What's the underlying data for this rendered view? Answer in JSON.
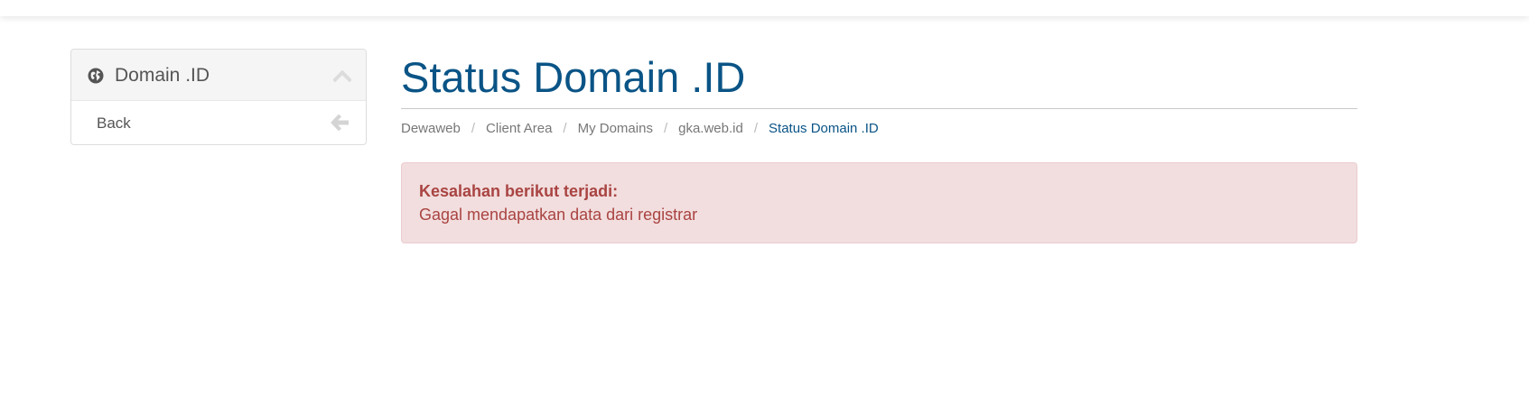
{
  "sidebar": {
    "title": "Domain .ID",
    "globe_icon": "globe-icon",
    "collapse_icon": "chevron-up-icon",
    "items": [
      {
        "label": "Back",
        "icon": "arrow-left-icon"
      }
    ]
  },
  "main": {
    "title": "Status Domain .ID",
    "breadcrumb": [
      {
        "label": "Dewaweb"
      },
      {
        "label": "Client Area"
      },
      {
        "label": "My Domains"
      },
      {
        "label": "gka.web.id"
      },
      {
        "label": "Status Domain .ID"
      }
    ],
    "separator": "/",
    "alert": {
      "heading": "Kesalahan berikut terjadi:",
      "message": "Gagal mendapatkan data dari registrar"
    }
  },
  "colors": {
    "title": "#0a5486",
    "alert_bg": "#f2dede",
    "alert_text": "#a94442",
    "panel_heading_bg": "#f5f5f5"
  }
}
